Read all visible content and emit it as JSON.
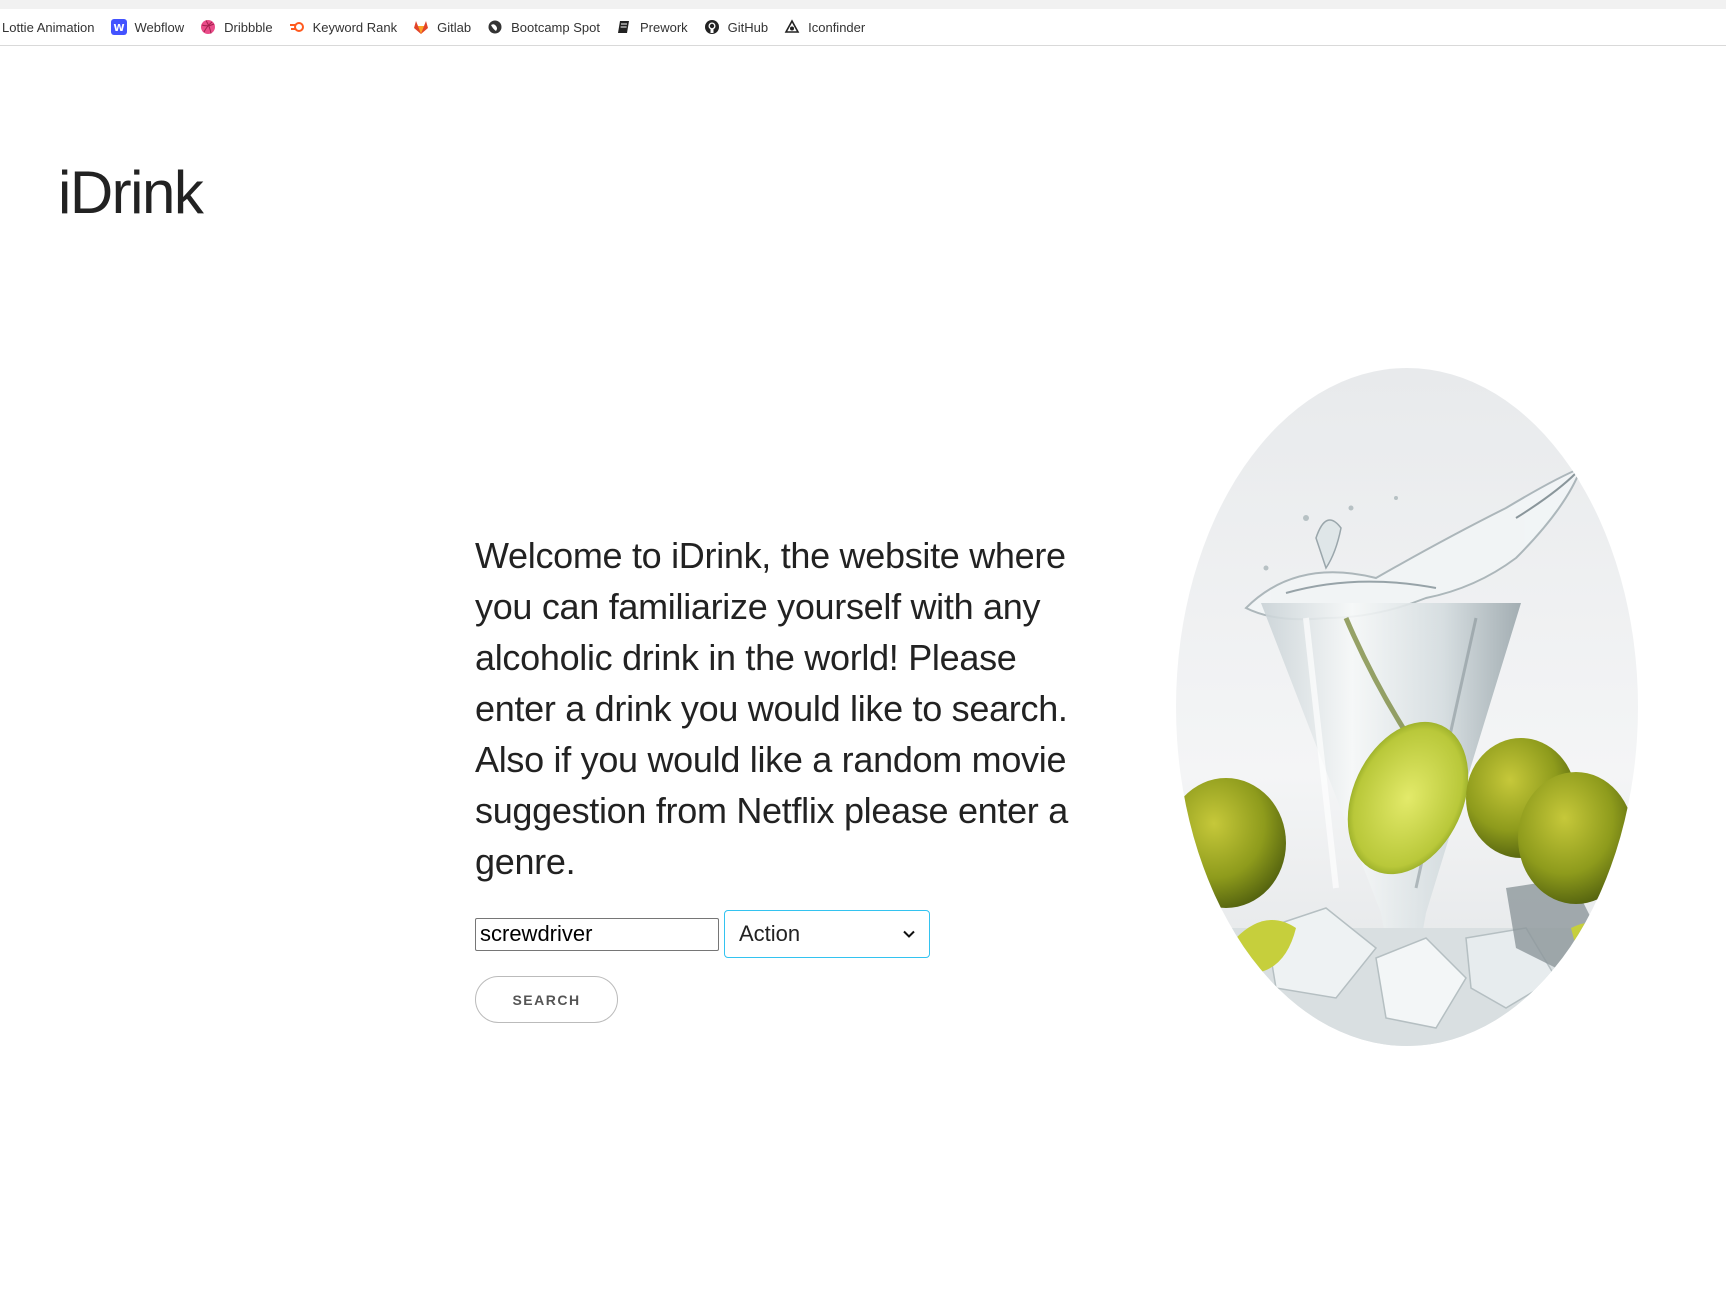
{
  "bookmarks": [
    {
      "label": "Lottie Animation",
      "icon": "none"
    },
    {
      "label": "Webflow",
      "icon": "webflow-icon",
      "color": "#4353ff"
    },
    {
      "label": "Dribbble",
      "icon": "dribbble-icon",
      "color": "#ea4c89"
    },
    {
      "label": "Keyword Rank",
      "icon": "keyword-rank-icon",
      "color": "#ff5a1f"
    },
    {
      "label": "Gitlab",
      "icon": "gitlab-icon",
      "color": "#e24329"
    },
    {
      "label": "Bootcamp Spot",
      "icon": "globe-icon",
      "color": "#333333"
    },
    {
      "label": "Prework",
      "icon": "book-icon",
      "color": "#222222"
    },
    {
      "label": "GitHub",
      "icon": "github-icon",
      "color": "#222222"
    },
    {
      "label": "Iconfinder",
      "icon": "iconfinder-icon",
      "color": "#222222"
    }
  ],
  "site": {
    "title": "iDrink"
  },
  "welcome": {
    "text": "Welcome to iDrink, the website where you can familiarize yourself with any alcoholic drink in the world! Please enter a drink you would like to search. Also if you would like a random movie suggestion from Netflix please enter a genre."
  },
  "search": {
    "drink_value": "screwdriver",
    "genre_selected": "Action",
    "button_label": "SEARCH"
  },
  "colors": {
    "select_border": "#33c3f0",
    "text": "#222222"
  },
  "hero": {
    "subject": "glass-with-lime-splash"
  }
}
